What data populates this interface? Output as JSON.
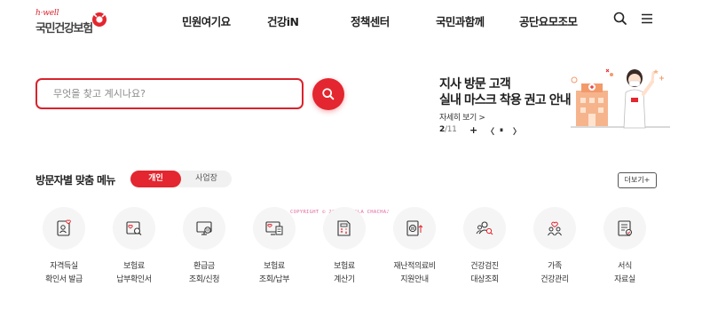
{
  "header": {
    "logo_sub": "h·well",
    "logo_name": "국민건강보험",
    "nav": [
      {
        "label": "민원여기요"
      },
      {
        "label": "건강iN"
      },
      {
        "label": "정책센터"
      },
      {
        "label": "국민과함께"
      },
      {
        "label": "공단요모조모"
      }
    ],
    "icons": {
      "search": "search-icon",
      "menu": "hamburger-icon"
    }
  },
  "search": {
    "placeholder": "무엇을 찾고 계시나요?",
    "value": "",
    "button_icon": "search-icon"
  },
  "banner": {
    "title_line1": "지사 방문 고객",
    "title_line2": "실내 마스크 착용 권고 안내",
    "more_label": "자세히 보기 >",
    "pager": {
      "current": "2",
      "total": "11",
      "separator": "/",
      "add": "+",
      "prev": "〈",
      "pause": "⏸",
      "next": "〉"
    }
  },
  "menu_section": {
    "title": "방문자별 맞춤 메뉴",
    "toggle": {
      "active": "개인",
      "inactive": "사업장"
    },
    "more_label": "더보기+",
    "items": [
      {
        "line1": "자격득실",
        "line2": "확인서 발급",
        "icon": "id-card-heart-icon"
      },
      {
        "line1": "보험료",
        "line2": "납부확인서",
        "icon": "document-search-icon"
      },
      {
        "line1": "환급금",
        "line2": "조회/신청",
        "icon": "monitor-won-icon"
      },
      {
        "line1": "보험료",
        "line2": "조회/납부",
        "icon": "monitor-bill-icon"
      },
      {
        "line1": "보험료",
        "line2": "계산기",
        "icon": "calculator-icon"
      },
      {
        "line1": "재난적의료비",
        "line2": "지원안내",
        "icon": "won-upload-icon"
      },
      {
        "line1": "건강검진",
        "line2": "대상조회",
        "icon": "people-search-icon"
      },
      {
        "line1": "가족",
        "line2": "건강관리",
        "icon": "family-heart-icon"
      },
      {
        "line1": "서식",
        "line2": "자료실",
        "icon": "form-document-icon"
      }
    ]
  },
  "watermark": "COPYRIGHT © 2023 LALALA CHACHA♪",
  "colors": {
    "brand_red": "#e3262f",
    "text": "#222222",
    "circle_bg": "#f5f5f5"
  }
}
